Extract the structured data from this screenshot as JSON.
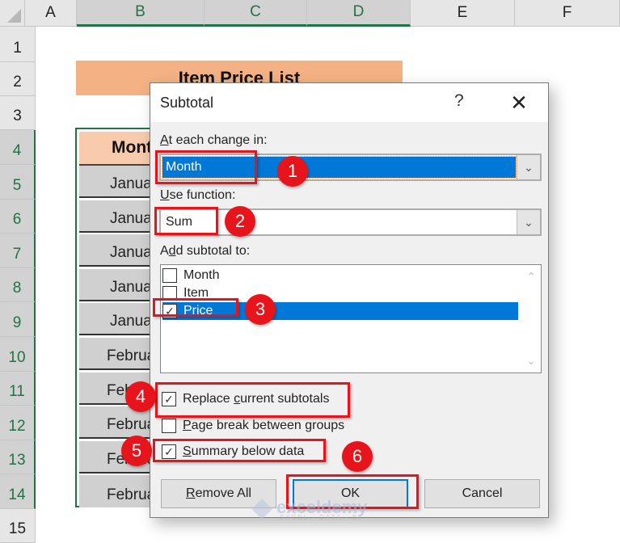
{
  "sheet": {
    "columns": [
      "A",
      "B",
      "C",
      "D",
      "E",
      "F"
    ],
    "selected_columns": [
      "B",
      "C",
      "D"
    ],
    "rows": [
      "1",
      "2",
      "3",
      "4",
      "5",
      "6",
      "7",
      "8",
      "9",
      "10",
      "11",
      "12",
      "13",
      "14",
      "15"
    ],
    "selected_rows": [
      "4",
      "5",
      "6",
      "7",
      "8",
      "9",
      "10",
      "11",
      "12",
      "13",
      "14"
    ],
    "title": "Item Price List",
    "table_header": "Month",
    "table_rows": [
      "January",
      "January",
      "January",
      "January",
      "January",
      "February",
      "February",
      "February",
      "February",
      "February"
    ]
  },
  "dialog": {
    "title": "Subtotal",
    "help_label": "?",
    "close_label": "✕",
    "at_each_change_label_prefix": "A",
    "at_each_change_label_rest": "t each change in:",
    "at_each_change_value": "Month",
    "use_function_label_prefix": "U",
    "use_function_label_rest": "se function:",
    "use_function_value": "Sum",
    "add_subtotal_label_a": "A",
    "add_subtotal_label_u": "d",
    "add_subtotal_label_rest": "d subtotal to:",
    "add_subtotal_items": [
      {
        "label": "Month",
        "checked": false
      },
      {
        "label": "Item",
        "checked": false
      },
      {
        "label": "Price",
        "checked": true
      }
    ],
    "replace_current": {
      "pre": "Replace ",
      "u": "c",
      "post": "urrent subtotals",
      "checked": true
    },
    "page_break": {
      "pre": "",
      "u": "P",
      "post": "age break between groups",
      "checked": false
    },
    "summary_below": {
      "pre": "",
      "u": "S",
      "post": "ummary below data",
      "checked": true
    },
    "remove_all": {
      "u": "R",
      "rest": "emove All"
    },
    "ok_label": "OK",
    "cancel_label": "Cancel"
  },
  "annotations": {
    "step_numbers": [
      "1",
      "2",
      "3",
      "4",
      "5",
      "6"
    ],
    "highlight_color": "#e8141b"
  },
  "watermark": {
    "brand": "exceldemy",
    "tagline": "EXCEL · DATA · BI"
  },
  "colors": {
    "excel_green": "#217346",
    "selection_blue": "#0078d7",
    "title_band": "#f4b183",
    "header_fill": "#f8cbad",
    "row_fill": "#d0d0d0"
  }
}
